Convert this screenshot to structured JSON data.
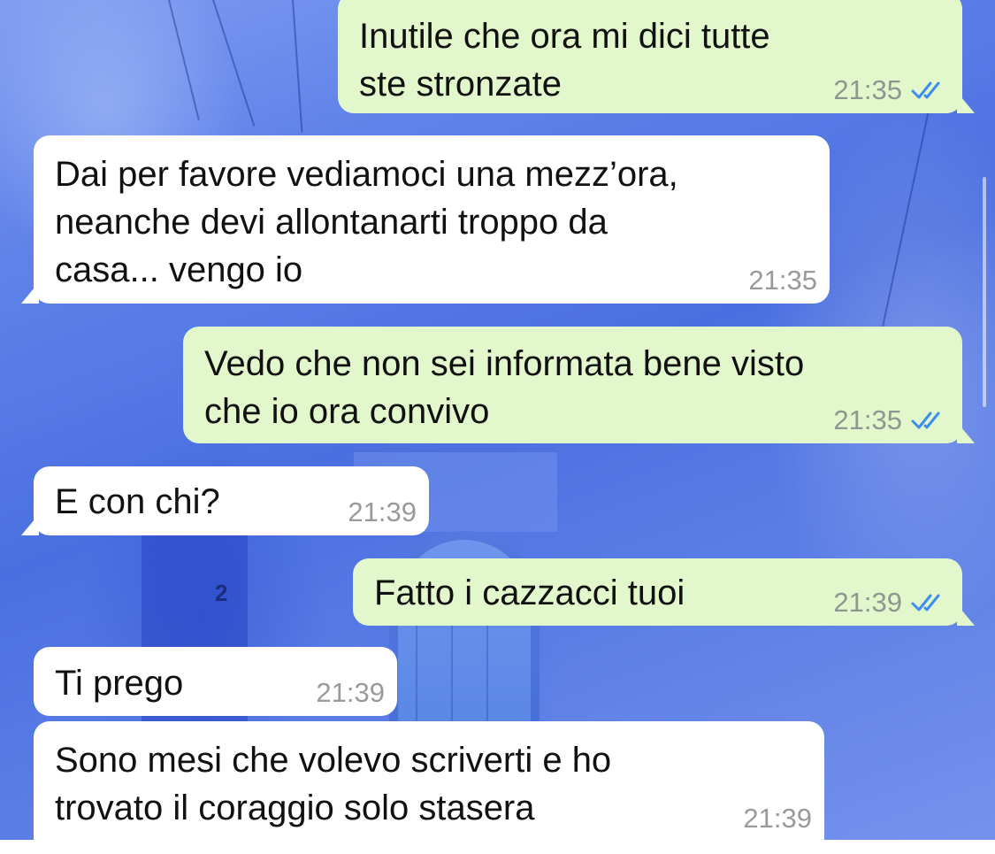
{
  "messages": [
    {
      "direction": "out",
      "lines": [
        "Inutile che ora mi dici tutte",
        "ste stronzate"
      ],
      "time": "21:35",
      "status": "read"
    },
    {
      "direction": "in",
      "lines": [
        "Dai per favore vediamoci una mezz’ora,",
        "neanche devi allontanarti troppo da",
        "casa... vengo io"
      ],
      "time": "21:35"
    },
    {
      "direction": "out",
      "lines": [
        "Vedo che non sei informata bene visto",
        "che io ora convivo"
      ],
      "time": "21:35",
      "status": "read"
    },
    {
      "direction": "in",
      "lines": [
        "E con chi?"
      ],
      "time": "21:39"
    },
    {
      "direction": "out",
      "lines": [
        "Fatto i cazzacci tuoi"
      ],
      "time": "21:39",
      "status": "read"
    },
    {
      "direction": "in",
      "lines": [
        "Ti prego"
      ],
      "time": "21:39"
    },
    {
      "direction": "in",
      "lines": [
        "Sono mesi che volevo scriverti e ho",
        "trovato il coraggio solo stasera"
      ],
      "time": "21:39"
    }
  ],
  "wallpaper": {
    "number": "2"
  },
  "colors": {
    "outgoing_bubble": "#e2f7cb",
    "incoming_bubble": "#ffffff",
    "read_ticks": "#3d8ef0"
  },
  "icons": {
    "read_receipt": "double-check-icon"
  }
}
